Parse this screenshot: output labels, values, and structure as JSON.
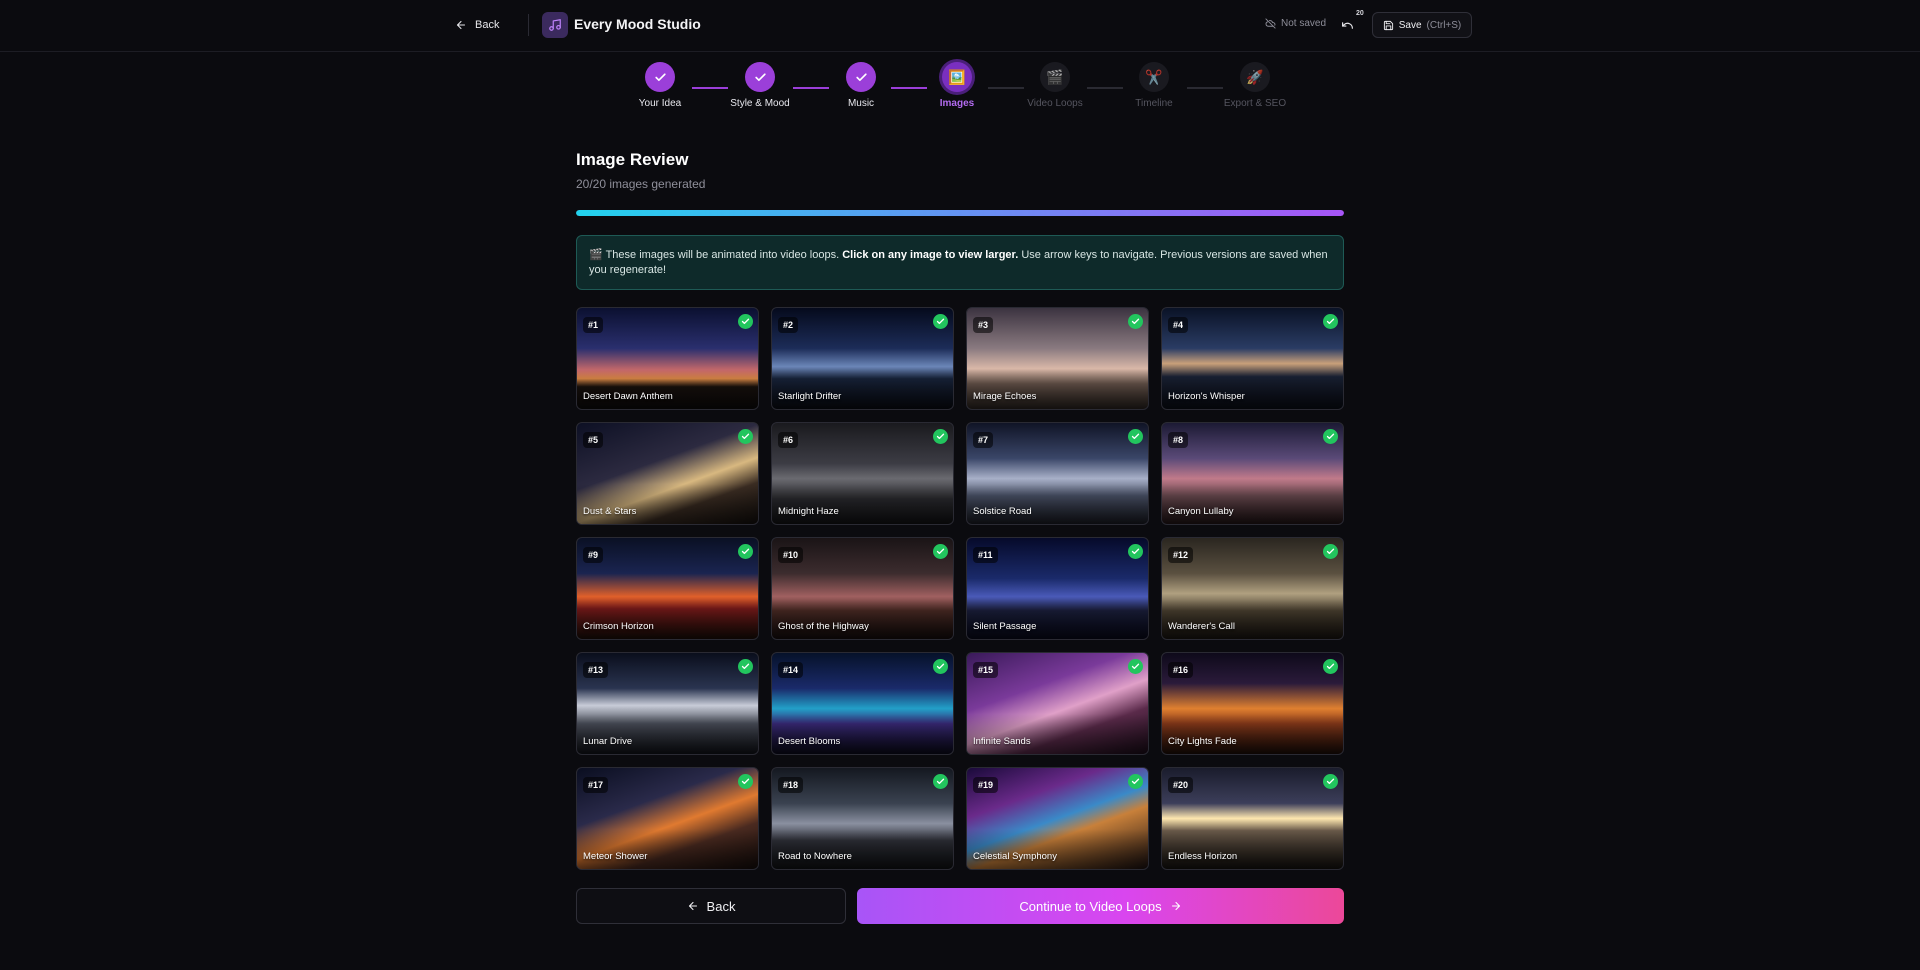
{
  "topbar": {
    "back_label": "Back",
    "app_title": "Every Mood Studio",
    "save_status": "Not saved",
    "undo_count": "20",
    "save_label": "Save",
    "save_shortcut": "(Ctrl+S)"
  },
  "stepper": {
    "steps": [
      {
        "label": "Your Idea",
        "state": "done",
        "icon": "check-icon"
      },
      {
        "label": "Style & Mood",
        "state": "done",
        "icon": "check-icon"
      },
      {
        "label": "Music",
        "state": "done",
        "icon": "check-icon"
      },
      {
        "label": "Images",
        "state": "active",
        "icon": "🖼️"
      },
      {
        "label": "Video Loops",
        "state": "todo",
        "icon": "🎬"
      },
      {
        "label": "Timeline",
        "state": "todo",
        "icon": "✂️"
      },
      {
        "label": "Export & SEO",
        "state": "todo",
        "icon": "🚀"
      }
    ]
  },
  "header": {
    "title": "Image Review",
    "subtitle": "20/20 images generated",
    "progress": 1.0
  },
  "info": {
    "icon": "🎬",
    "text_before": "These images will be animated into video loops.",
    "text_bold": "Click on any image to view larger.",
    "text_after": "Use arrow keys to navigate. Previous versions are saved when you regenerate!"
  },
  "images": [
    {
      "num": "#1",
      "name": "Desert Dawn Anthem",
      "approved": true
    },
    {
      "num": "#2",
      "name": "Starlight Drifter",
      "approved": true
    },
    {
      "num": "#3",
      "name": "Mirage Echoes",
      "approved": true
    },
    {
      "num": "#4",
      "name": "Horizon's Whisper",
      "approved": true
    },
    {
      "num": "#5",
      "name": "Dust & Stars",
      "approved": true
    },
    {
      "num": "#6",
      "name": "Midnight Haze",
      "approved": true
    },
    {
      "num": "#7",
      "name": "Solstice Road",
      "approved": true
    },
    {
      "num": "#8",
      "name": "Canyon Lullaby",
      "approved": true
    },
    {
      "num": "#9",
      "name": "Crimson Horizon",
      "approved": true
    },
    {
      "num": "#10",
      "name": "Ghost of the Highway",
      "approved": true
    },
    {
      "num": "#11",
      "name": "Silent Passage",
      "approved": true
    },
    {
      "num": "#12",
      "name": "Wanderer's Call",
      "approved": true
    },
    {
      "num": "#13",
      "name": "Lunar Drive",
      "approved": true
    },
    {
      "num": "#14",
      "name": "Desert Blooms",
      "approved": true
    },
    {
      "num": "#15",
      "name": "Infinite Sands",
      "approved": true
    },
    {
      "num": "#16",
      "name": "City Lights Fade",
      "approved": true
    },
    {
      "num": "#17",
      "name": "Meteor Shower",
      "approved": true
    },
    {
      "num": "#18",
      "name": "Road to Nowhere",
      "approved": true
    },
    {
      "num": "#19",
      "name": "Celestial Symphony",
      "approved": true
    },
    {
      "num": "#20",
      "name": "Endless Horizon",
      "approved": true
    }
  ],
  "footer": {
    "back_label": "Back",
    "continue_label": "Continue to Video Loops"
  },
  "colors": {
    "accent": "#9b3fd9",
    "approved": "#22c55e",
    "info_bg": "#0e2a2a"
  }
}
